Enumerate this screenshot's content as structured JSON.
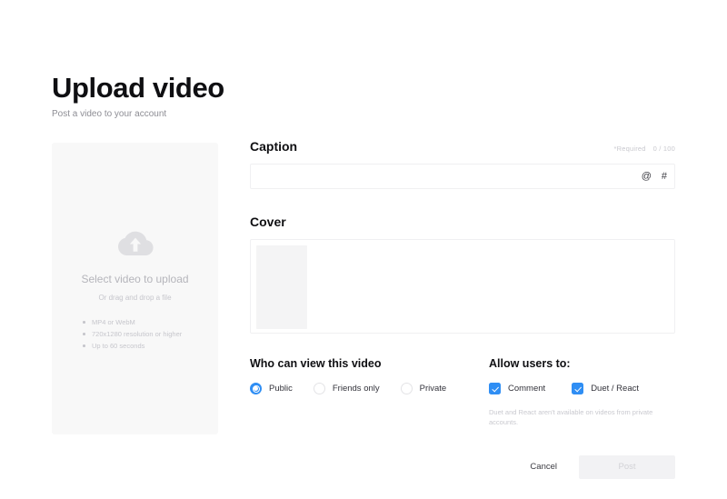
{
  "header": {
    "title": "Upload video",
    "subtitle": "Post a video to your account"
  },
  "upload_panel": {
    "icon": "cloud-upload-icon",
    "title": "Select video to upload",
    "subtitle": "Or drag and drop a file",
    "requirements": [
      "MP4 or WebM",
      "720x1280 resolution or higher",
      "Up to 60 seconds"
    ]
  },
  "caption": {
    "label": "Caption",
    "required_note": "*Required",
    "counter": "0 / 100",
    "value": "",
    "placeholder": "",
    "mention_icon": "@",
    "hashtag_icon": "#"
  },
  "cover": {
    "label": "Cover",
    "thumbnail_alt": "cover-thumbnail-placeholder"
  },
  "privacy": {
    "title": "Who can view this video",
    "options": [
      {
        "label": "Public",
        "selected": true
      },
      {
        "label": "Friends only",
        "selected": false
      },
      {
        "label": "Private",
        "selected": false
      }
    ]
  },
  "permissions": {
    "title": "Allow users to:",
    "options": [
      {
        "label": "Comment",
        "checked": true
      },
      {
        "label": "Duet / React",
        "checked": true
      }
    ],
    "note": "Duet and React aren't available on videos from private accounts."
  },
  "footer": {
    "cancel_label": "Cancel",
    "post_label": "Post",
    "post_disabled": true
  },
  "colors": {
    "accent": "#2f8ef4",
    "text_primary": "#161823",
    "text_muted": "#c9c9cf",
    "panel_bg": "#f8f8f8",
    "border": "#f0f0f2",
    "button_disabled_bg": "#f2f2f4"
  }
}
